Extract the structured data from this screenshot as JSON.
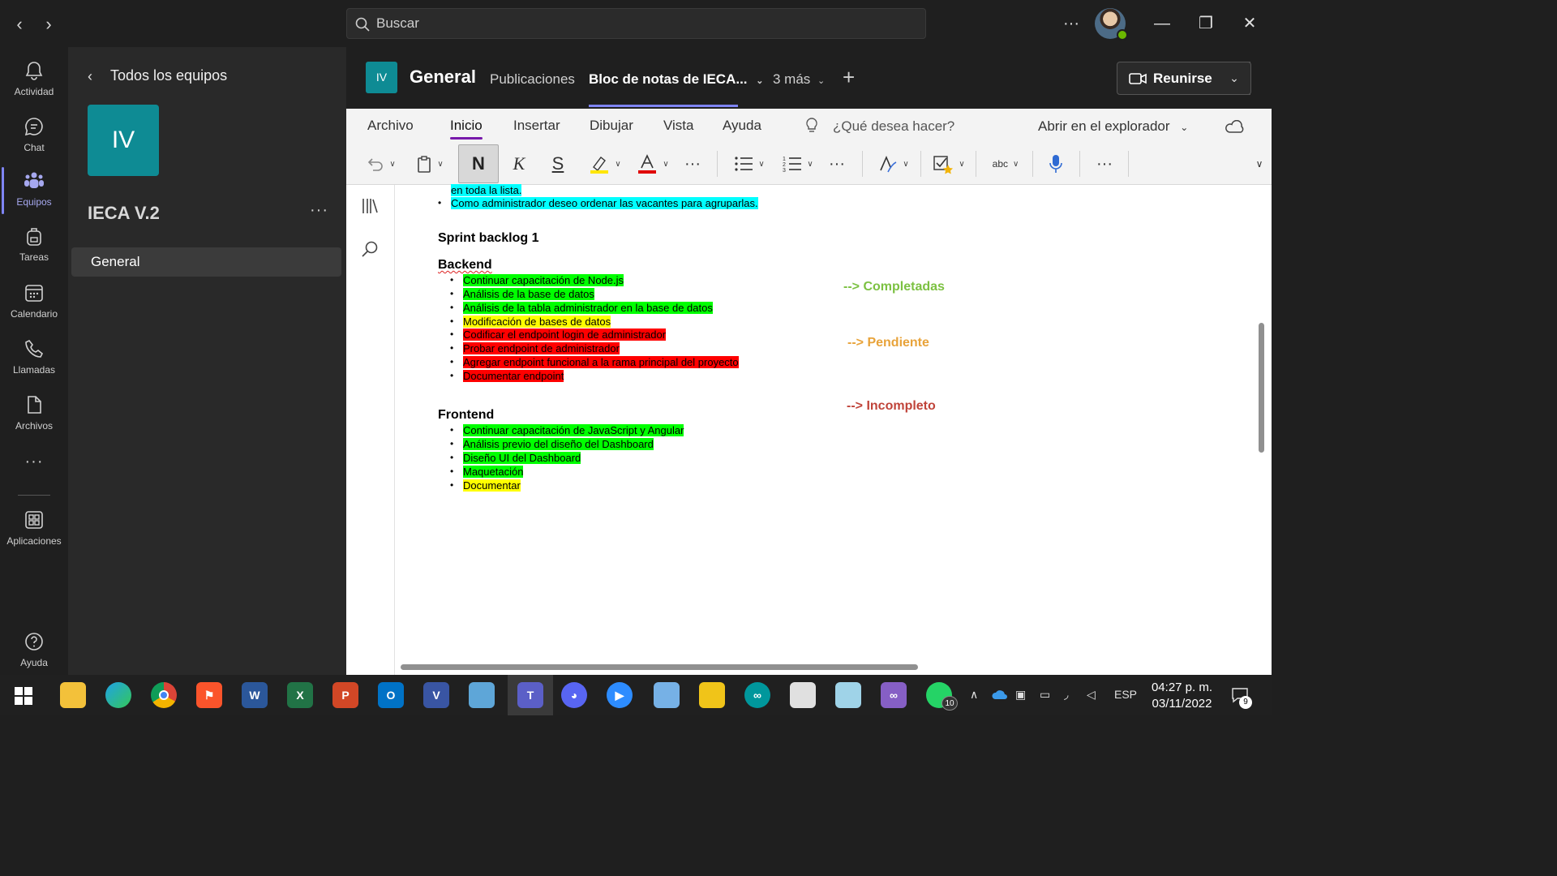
{
  "titlebar": {
    "search_placeholder": "Buscar",
    "more_label": "···"
  },
  "rail": {
    "items": [
      {
        "label": "Actividad",
        "icon": "bell-icon"
      },
      {
        "label": "Chat",
        "icon": "chat-icon"
      },
      {
        "label": "Equipos",
        "icon": "teams-icon",
        "active": true
      },
      {
        "label": "Tareas",
        "icon": "backpack-icon"
      },
      {
        "label": "Calendario",
        "icon": "calendar-icon"
      },
      {
        "label": "Llamadas",
        "icon": "phone-icon"
      },
      {
        "label": "Archivos",
        "icon": "file-icon"
      }
    ],
    "more": "···",
    "apps_label": "Aplicaciones",
    "help_label": "Ayuda"
  },
  "team_panel": {
    "back_label": "Todos los equipos",
    "team_initials": "IV",
    "team_name": "IECA V.2",
    "more": "···",
    "channels": [
      {
        "label": "General"
      }
    ]
  },
  "channel_header": {
    "initials": "IV",
    "title": "General",
    "tabs": [
      {
        "label": "Publicaciones"
      },
      {
        "label": "Bloc de notas de IECA..."
      },
      {
        "label": "3 más"
      }
    ],
    "meet_label": "Reunirse"
  },
  "ribbon": {
    "tabs": [
      "Archivo",
      "Inicio",
      "Insertar",
      "Dibujar",
      "Vista",
      "Ayuda"
    ],
    "active_tab": "Inicio",
    "tell_me": "¿Qué desea hacer?",
    "open_in": "Abrir en el explorador",
    "bold": "N",
    "italic": "K",
    "strike": "S",
    "spell": "abc",
    "more": "···"
  },
  "note": {
    "intro_lines": [
      {
        "text": "en toda la lista.",
        "hl": "cyan"
      },
      {
        "text": "Como administrador deseo ordenar las vacantes para agruparlas.",
        "hl": "cyan"
      }
    ],
    "sprint_title": "Sprint backlog 1",
    "backend_title": "Backend",
    "backend_items": [
      {
        "text": "Continuar capacitación de Node.js",
        "hl": "green"
      },
      {
        "text": "Análisis de la base de datos",
        "hl": "green"
      },
      {
        "text": "Análisis de la tabla administrador en la base de datos",
        "hl": "green"
      },
      {
        "text": "Modificación de bases de datos",
        "hl": "yellow"
      },
      {
        "text": "Codificar el endpoint login de administrador",
        "hl": "red"
      },
      {
        "text": "Probar endpoint de administrador",
        "hl": "red"
      },
      {
        "text": "Agregar endpoint funcional a la rama principal del proyecto",
        "hl": "red"
      },
      {
        "text": "Documentar endpoint",
        "hl": "red"
      }
    ],
    "frontend_title": "Frontend",
    "frontend_items": [
      {
        "text": "Continuar capacitación de JavaScript y Angular",
        "hl": "green"
      },
      {
        "text": "Análisis previo del diseño del Dashboard",
        "hl": "green"
      },
      {
        "text": "Diseño UI del Dashboard",
        "hl": "green"
      },
      {
        "text": "Maquetación",
        "hl": "green"
      },
      {
        "text": "Documentar",
        "hl": "yellow"
      }
    ],
    "legend": [
      {
        "text": "--> Completadas",
        "color": "#7cc142"
      },
      {
        "text": "--> Pendiente",
        "color": "#e8a33a"
      },
      {
        "text": "--> Incompleto",
        "color": "#c0443a"
      }
    ]
  },
  "taskbar": {
    "apps": [
      "windows-start",
      "file-explorer",
      "edge",
      "chrome",
      "brave",
      "word",
      "excel",
      "powerpoint",
      "outlook",
      "visio",
      "control-panel",
      "teams",
      "discord",
      "zoom",
      "virtualbox",
      "snipping",
      "arduino",
      "paint",
      "mail",
      "visual-studio",
      "whatsapp"
    ],
    "whatsapp_badge": "10",
    "lang": "ESP",
    "time": "04:27 p. m.",
    "date": "03/11/2022",
    "notifications": "9"
  },
  "colors": {
    "accent": "#7f85f5",
    "team_tile": "#0e8b94",
    "ribbon_active": "#7719aa"
  }
}
